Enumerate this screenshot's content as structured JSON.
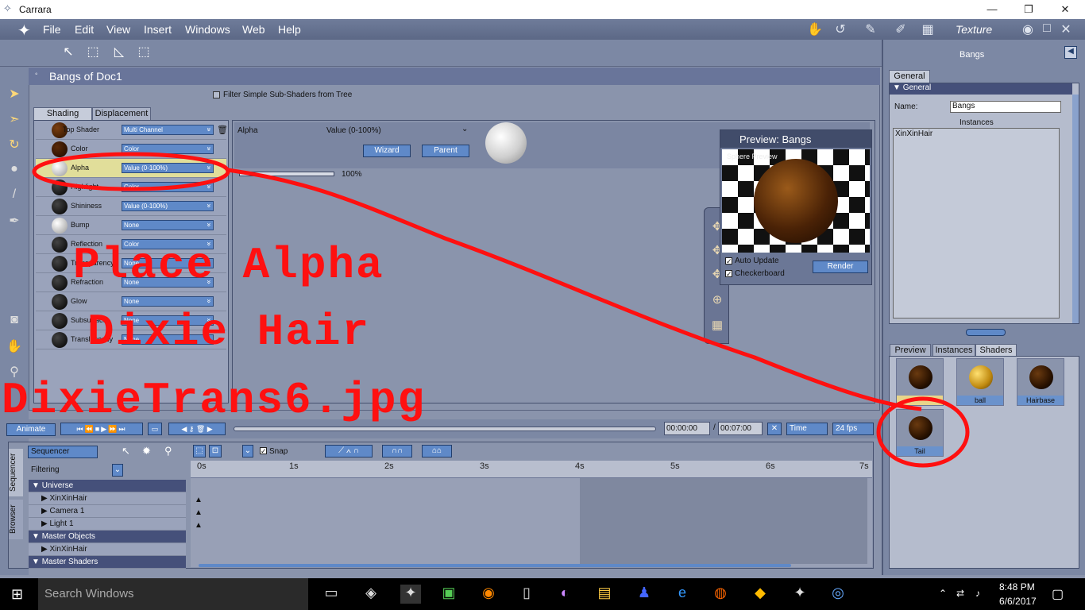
{
  "titlebar": {
    "app_title": "Carrara",
    "minimize": "—",
    "maximize": "❐",
    "close": "✕"
  },
  "menu": {
    "items": [
      "File",
      "Edit",
      "View",
      "Insert",
      "Windows",
      "Web",
      "Help"
    ],
    "room_label": "Texture"
  },
  "shader_panel": {
    "title": "Bangs of Doc1",
    "filter_label": "Filter Simple Sub-Shaders from Tree",
    "tabs": [
      "Shading",
      "Displacement"
    ],
    "rows": [
      {
        "label": "Top Shader",
        "value": "Multi Channel"
      },
      {
        "label": "Color",
        "value": "Color"
      },
      {
        "label": "Alpha",
        "value": "Value (0-100%)"
      },
      {
        "label": "Highlight",
        "value": "Color"
      },
      {
        "label": "Shininess",
        "value": "Value (0-100%)"
      },
      {
        "label": "Bump",
        "value": "None"
      },
      {
        "label": "Reflection",
        "value": "Color"
      },
      {
        "label": "Transparency",
        "value": "None"
      },
      {
        "label": "Refraction",
        "value": "None"
      },
      {
        "label": "Glow",
        "value": "None"
      },
      {
        "label": "Subsurface",
        "value": "None"
      },
      {
        "label": "Translucency",
        "value": "None"
      }
    ],
    "editor": {
      "channel": "Alpha",
      "type": "Value (0-100%)",
      "wizard": "Wizard",
      "parent": "Parent",
      "slider_value": "100%"
    }
  },
  "preview": {
    "title": "Preview: Bangs",
    "overlay": "Sphere Preview",
    "auto_update": "Auto Update",
    "checkerboard": "Checkerboard",
    "render": "Render"
  },
  "right_panel": {
    "header": "Bangs",
    "tab_general": "General",
    "section": "General",
    "name_label": "Name:",
    "name_value": "Bangs",
    "instances_label": "Instances",
    "instance_item": "XinXinHair",
    "lower_tabs": [
      "Preview",
      "Instances",
      "Shaders"
    ],
    "shaders": [
      "",
      "ball",
      "Hairbase",
      "Tail"
    ]
  },
  "transport": {
    "animate": "Animate",
    "time_current": "00:00:00",
    "time_sep": "/",
    "time_end": "00:07:00",
    "mode": "Time",
    "fps": "24 fps"
  },
  "sequencer": {
    "mode": "Sequencer",
    "snap": "Snap",
    "filtering": "Filtering",
    "side_tabs": [
      "Sequencer",
      "Browser"
    ],
    "ticks": [
      "0s",
      "1s",
      "2s",
      "3s",
      "4s",
      "5s",
      "6s",
      "7s"
    ],
    "rows": [
      {
        "label": "Universe",
        "header": true
      },
      {
        "label": "XinXinHair",
        "header": false
      },
      {
        "label": "Camera 1",
        "header": false
      },
      {
        "label": "Light 1",
        "header": false
      },
      {
        "label": "Master Objects",
        "header": true
      },
      {
        "label": "XinXinHair",
        "header": false
      },
      {
        "label": "Master Shaders",
        "header": true
      }
    ]
  },
  "annotation": {
    "line1": "Place Alpha",
    "line2": "Dixie Hair",
    "line3": "DixieTrans6.jpg",
    "color": "#ff1010"
  },
  "taskbar": {
    "search": "Search Windows",
    "time": "8:48 PM",
    "date": "6/6/2017"
  }
}
